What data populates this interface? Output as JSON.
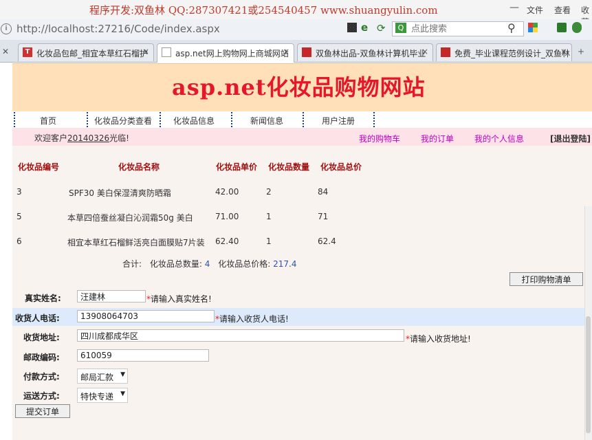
{
  "browser": {
    "dev_note": "程序开发:双鱼林 QQ:287307421或254540457 www.shuangyulin.com",
    "menu": {
      "file": "文件",
      "view": "查看",
      "favorites": "收藏"
    },
    "address": "http://localhost:27216/Code/index.aspx",
    "search_placeholder": "点此搜索",
    "tabs": [
      {
        "label": "化妆品包邮_相宜本草红石榴护",
        "icon_color": "#d32f2f",
        "icon_text": "T"
      },
      {
        "label": "asp.net网上购物网上商城网站",
        "icon_color": "#ffffff",
        "icon_text": ""
      },
      {
        "label": "双鱼林出品-双鱼林计算机毕业",
        "icon_color": "#c62828",
        "icon_text": ""
      },
      {
        "label": "免费_毕业课程范例设计_双鱼林",
        "icon_color": "#c62828",
        "icon_text": ""
      }
    ]
  },
  "site": {
    "title": "asp.net化妆品购物网站",
    "nav": [
      "首页",
      "化妆品分类查看",
      "化妆品信息",
      "新闻信息",
      "用户注册"
    ],
    "welcome_prefix": "欢迎客户",
    "welcome_user": "20140326",
    "welcome_suffix": "光临!",
    "links": {
      "cart": "我的购物车",
      "orders": "我的订单",
      "profile": "我的个人信息",
      "logout": "[退出登陆]"
    }
  },
  "cart": {
    "headers": [
      "化妆品编号",
      "化妆品名称",
      "化妆品单价",
      "化妆品数量",
      "化妆品总价"
    ],
    "rows": [
      {
        "id": "3",
        "name": "SPF30 美白保湿清爽防晒霜",
        "price": "42.00",
        "qty": "2",
        "total": "84"
      },
      {
        "id": "5",
        "name": "本草四倍蚕丝凝白沁润霜50g 美白",
        "price": "71.00",
        "qty": "1",
        "total": "71"
      },
      {
        "id": "6",
        "name": "相宜本草红石榴鲜活亮白面膜贴7片装",
        "price": "62.40",
        "qty": "1",
        "total": "62.4"
      }
    ],
    "summary_label": "合计:",
    "count_label": "化妆品总数量:",
    "count_value": "4",
    "price_label": "化妆品总价格:",
    "price_value": "217.4",
    "print_button": "打印购物清单"
  },
  "form": {
    "name_label": "真实姓名:",
    "name_value": "汪建林",
    "name_hint": "请输入真实姓名!",
    "phone_label": "收货人电话:",
    "phone_value": "13908064703",
    "phone_hint": "请输入收货人电话!",
    "address_label": "收货地址:",
    "address_value": "四川成都成华区",
    "address_hint": "请输入收货地址!",
    "postcode_label": "邮政编码:",
    "postcode_value": "610059",
    "payment_label": "付款方式:",
    "payment_value": "邮局汇款",
    "shipping_label": "运送方式:",
    "shipping_value": "特快专递",
    "submit_button": "提交订单",
    "required_mark": "*"
  }
}
